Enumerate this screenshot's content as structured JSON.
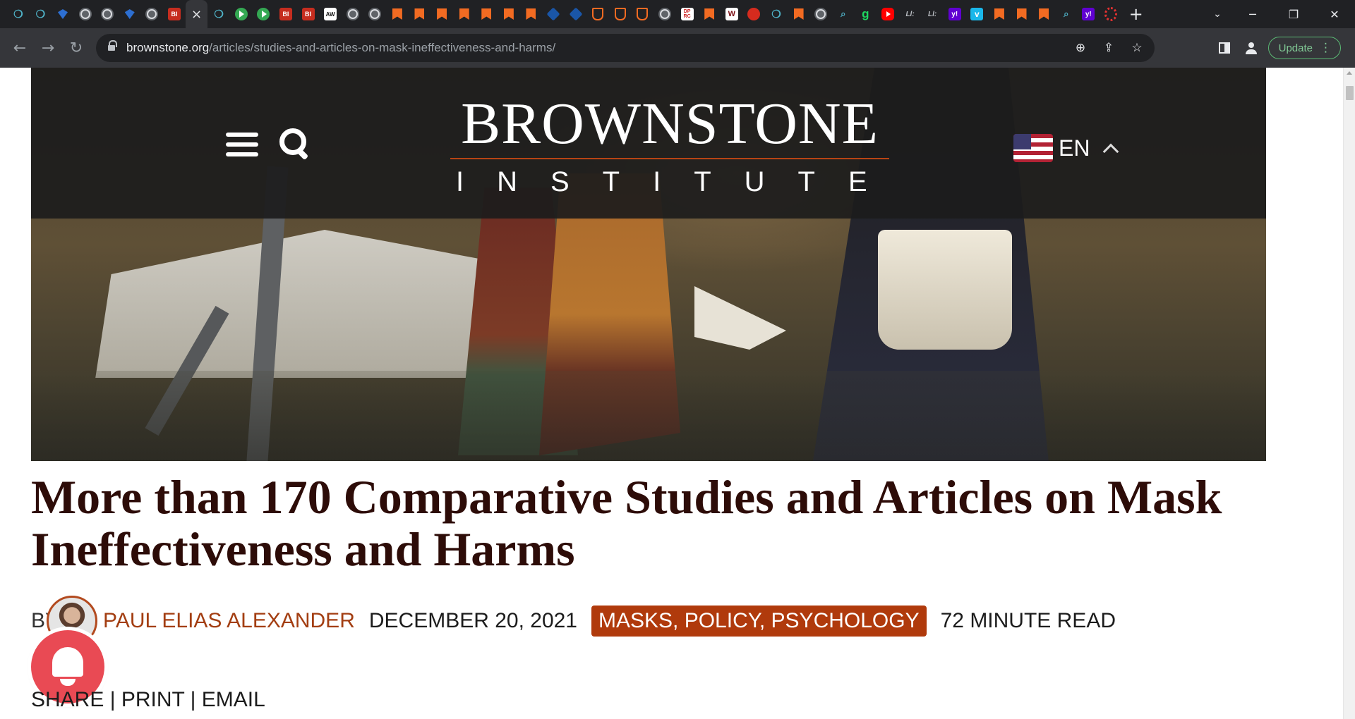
{
  "browser": {
    "active_tab_close": "×",
    "new_tab": "+",
    "tab_favicons": [
      "teal-icon",
      "teal-icon",
      "blue-arrow-icon",
      "globe-icon",
      "globe-icon",
      "blue-shield-icon",
      "globe-icon",
      "bi-icon",
      "close-icon",
      "teal-icon",
      "play-icon",
      "play-icon",
      "bi-icon",
      "bi-icon",
      "paper-icon",
      "globe-icon",
      "globe-icon",
      "bookmark-icon",
      "bookmark-icon",
      "bookmark-icon",
      "bookmark-icon",
      "bookmark-icon",
      "bookmark-icon",
      "bookmark-icon",
      "cube-icon",
      "cube-icon",
      "shield-icon",
      "shield-icon",
      "shield-icon",
      "globe-icon",
      "dprc-icon",
      "bookmark-icon",
      "monogram-icon",
      "red-icon",
      "teal-icon",
      "bookmark-icon",
      "globe-icon",
      "search-icon",
      "g-icon",
      "youtube-icon",
      "wp-icon",
      "wp-icon",
      "yahoo-icon",
      "vimeo-icon",
      "bookmark-icon",
      "bookmark-icon",
      "bookmark-icon",
      "search-icon",
      "yahoo-icon",
      "cbc-icon"
    ],
    "url_host": "brownstone.org",
    "url_path": "/articles/studies-and-articles-on-mask-ineffectiveness-and-harms/",
    "update_label": "Update",
    "accent": "#81c995"
  },
  "site": {
    "logo_line1": "BROWNSTONE",
    "logo_line2": "INSTITUTE",
    "language": "EN",
    "brand_color": "#b03a0c"
  },
  "article": {
    "title": "More than 170 Comparative Studies and Articles on Mask Ineffectiveness and Harms",
    "by": "BY",
    "author": "PAUL ELIAS ALEXANDER",
    "date": "DECEMBER 20, 2021",
    "tags": "MASKS, POLICY, PSYCHOLOGY",
    "read_time": "72 MINUTE READ",
    "share": "SHARE",
    "print": "PRINT",
    "email": "EMAIL",
    "separator": "|"
  }
}
